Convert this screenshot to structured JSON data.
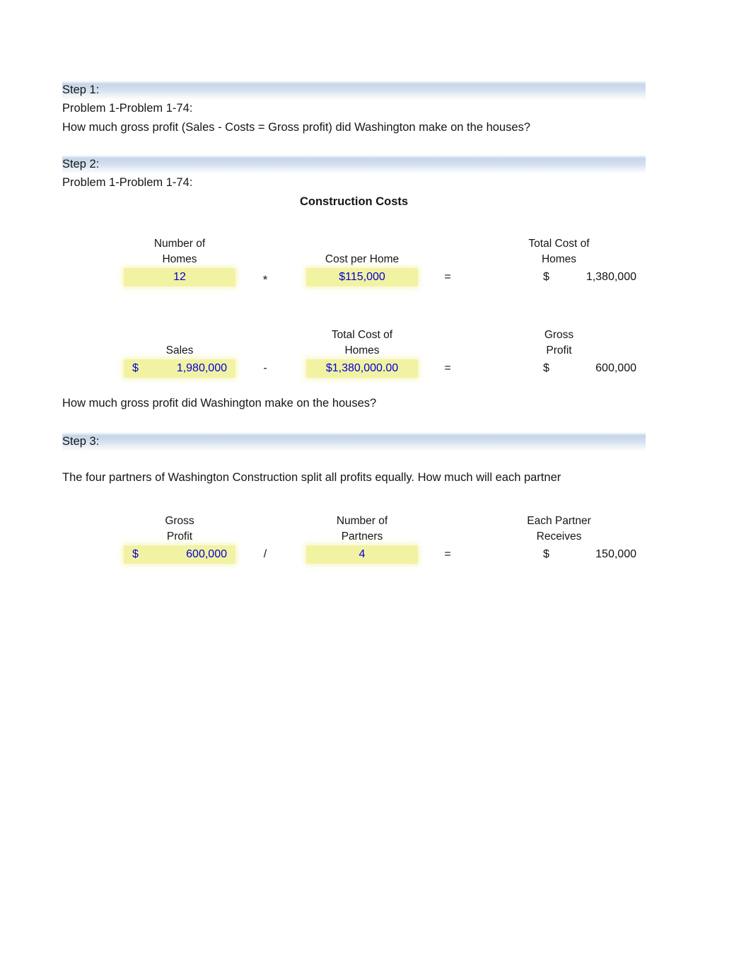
{
  "document": {
    "title": "Construction Costs",
    "accent_header_color": "#c6d6ea",
    "highlight_color": "#f2f2a3",
    "input_text_color": "#0000d4"
  },
  "steps": [
    {
      "banner": "Step 1:",
      "lines": [
        "Problem 1-Problem 1-74:",
        "How much gross profit (Sales - Costs = Gross profit) did Washington make on the houses?"
      ]
    },
    {
      "banner": "Step 2:",
      "lines": [
        "Problem 1-Problem 1-74:"
      ],
      "section_title": "Construction Costs",
      "closing_line": "How much gross profit did Washington make on the houses?"
    },
    {
      "banner": "Step 3:",
      "lines": [
        "The four partners of Washington Construction split all profits equally. How much will each partner"
      ]
    }
  ],
  "calculations": [
    {
      "operand_a": {
        "header_line1": "Number of",
        "header_line2": "Homes",
        "currency": "",
        "value": "12",
        "highlighted": true,
        "align": "center"
      },
      "operator_1": "*",
      "operand_b": {
        "header_line1": "",
        "header_line2": "Cost per Home",
        "currency": "",
        "value": "$115,000",
        "highlighted": true,
        "align": "center"
      },
      "operator_2": "=",
      "result": {
        "header_line1": "Total Cost of",
        "header_line2": "Homes",
        "currency": "$",
        "value": "1,380,000"
      }
    },
    {
      "operand_a": {
        "header_line1": "",
        "header_line2": "Sales",
        "currency": "$",
        "value": "1,980,000",
        "highlighted": true,
        "align": "right"
      },
      "operator_1": "-",
      "operand_b": {
        "header_line1": "Total Cost of",
        "header_line2": "Homes",
        "currency": "",
        "value": "$1,380,000.00",
        "highlighted": true,
        "align": "center"
      },
      "operator_2": "=",
      "result": {
        "header_line1": "Gross",
        "header_line2": "Profit",
        "currency": "$",
        "value": "600,000"
      }
    },
    {
      "operand_a": {
        "header_line1": "Gross",
        "header_line2": "Profit",
        "currency": "$",
        "value": "600,000",
        "highlighted": true,
        "align": "right"
      },
      "operator_1": "/",
      "operand_b": {
        "header_line1": "Number of",
        "header_line2": "Partners",
        "currency": "",
        "value": "4",
        "highlighted": true,
        "align": "center"
      },
      "operator_2": "=",
      "result": {
        "header_line1": "Each Partner",
        "header_line2": "Receives",
        "currency": "$",
        "value": "150,000"
      }
    }
  ]
}
